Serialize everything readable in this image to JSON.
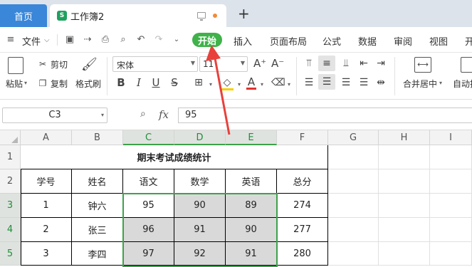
{
  "tabs": {
    "home": "首页",
    "doc_title": "工作簿2",
    "doc_icon": "S"
  },
  "menu": {
    "file": "文件",
    "items": [
      "开始",
      "插入",
      "页面布局",
      "公式",
      "数据",
      "审阅",
      "视图",
      "开"
    ]
  },
  "ribbon": {
    "paste": "粘贴",
    "cut": "剪切",
    "copy": "复制",
    "format_painter": "格式刷",
    "font_name": "宋体",
    "font_size": "11",
    "merge_center": "合并居中",
    "auto_wrap": "自动换"
  },
  "formula_bar": {
    "cell_ref": "C3",
    "value": "95",
    "fx": "fx"
  },
  "columns": [
    "A",
    "B",
    "C",
    "D",
    "E",
    "F",
    "G",
    "H",
    "I"
  ],
  "rows": [
    "1",
    "2",
    "3",
    "4",
    "5"
  ],
  "sheet": {
    "title": "期末考试成绩统计",
    "headers": [
      "学号",
      "姓名",
      "语文",
      "数学",
      "英语",
      "总分"
    ],
    "data": [
      [
        "1",
        "钟六",
        "95",
        "90",
        "89",
        "274"
      ],
      [
        "2",
        "张三",
        "96",
        "91",
        "90",
        "277"
      ],
      [
        "3",
        "李四",
        "97",
        "92",
        "91",
        "280"
      ]
    ]
  },
  "colors": {
    "accent_green": "#3fb24a",
    "home_tab": "#3a86d8",
    "annotation_arrow": "#e8413c"
  }
}
